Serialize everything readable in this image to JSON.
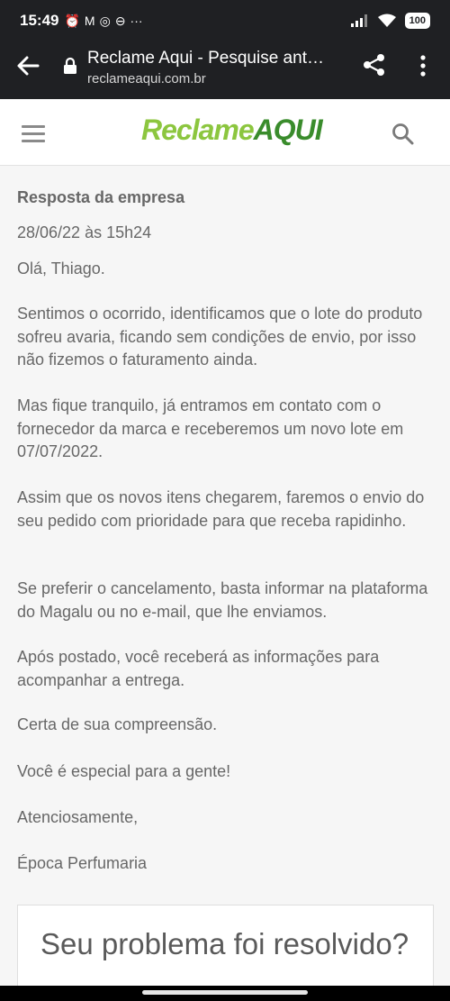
{
  "status_bar": {
    "time": "15:49",
    "battery": "100"
  },
  "browser": {
    "page_title": "Reclame Aqui - Pesquise ant…",
    "domain": "reclameaqui.com.br"
  },
  "site": {
    "logo_part1": "Reclame",
    "logo_part2": "AQUI"
  },
  "reply": {
    "title": "Resposta da empresa",
    "date": "28/06/22 às 15h24",
    "paragraphs": [
      "Olá, Thiago.",
      "Sentimos o ocorrido, identificamos que o lote do produto sofreu avaria, ficando sem condições de envio, por isso não fizemos o faturamento ainda.",
      "Mas fique tranquilo, já entramos em contato com o fornecedor da marca e receberemos um novo lote em 07/07/2022.",
      "Assim que os novos itens chegarem, faremos o envio do seu pedido com prioridade para que receba rapidinho.",
      "Se preferir o cancelamento, basta informar na plataforma do Magalu ou no e-mail, que lhe enviamos.",
      "Após postado, você receberá as informações para acompanhar a entrega.",
      "Certa de sua compreensão.",
      "Você é especial para a gente!",
      "Atenciosamente,",
      "Época Perfumaria"
    ]
  },
  "resolved": {
    "question": "Seu problema foi resolvido?"
  },
  "colors": {
    "logo_light_green": "#8cc63f",
    "logo_dark_green": "#3a8c2c",
    "text_gray": "#676767",
    "browser_bar": "#1f2023"
  }
}
